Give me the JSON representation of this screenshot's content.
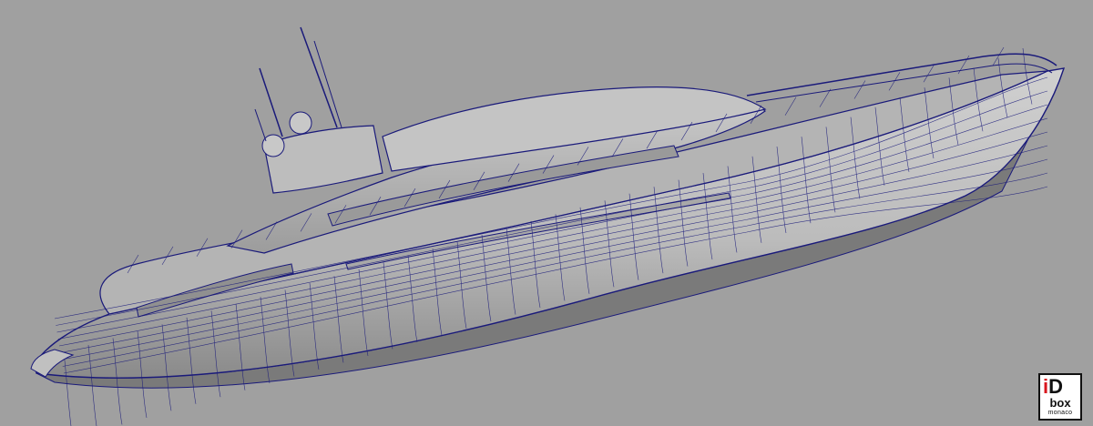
{
  "viewport": {
    "background": "#a0a0a0",
    "wire_color": "#1a1a7a",
    "surface_color": "#bdbdbd",
    "shadow_color": "#7d7d7d"
  },
  "logo": {
    "mark_i": "i",
    "mark_d": "D",
    "line2": "box",
    "line3": "monaco",
    "accent": "#d8161e"
  }
}
